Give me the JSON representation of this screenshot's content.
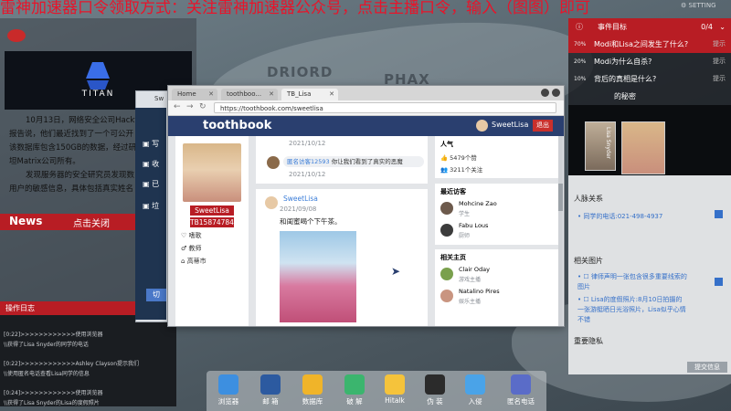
{
  "banner": {
    "text": "雷神加速器口令领取方式：关注雷神加速器公众号，点击主播口令，输入（图图）即可"
  },
  "topbar": {
    "setting_label": "SETTING"
  },
  "map": {
    "labels": [
      "DRIORD",
      "PHAX"
    ]
  },
  "news": {
    "logo_text": "TITAN",
    "paragraphs": [
      "10月13日，网络安全公司Hackt",
      "报告说，他们最近找到了一个可公开",
      "该数据库包含150GB的数据，经过研",
      "坦Matrix公司所有。",
      "发现服务器的安全研究员发现数",
      "用户的敏感信息，具体包括真实姓名"
    ],
    "tab_label": "News",
    "close_label": "点击关闭"
  },
  "opslog": {
    "title": "操作日志",
    "entries": [
      "[0:22]>>>>>>>>>>>>使用浏览器",
      "\\\\获得了Lisa Snyder的同学的电话",
      "[0:22]>>>>>>>>>>>>Ashley Clayson提示我们",
      "\\\\使用匿名电话查看Lisa同学的信息",
      "[0:24]>>>>>>>>>>>>使用浏览器",
      "\\\\获得了Lisa Snyder的Lisa的度假照片"
    ]
  },
  "mailwin": {
    "title_fragment": "Sw",
    "items": [
      "写",
      "收",
      "已",
      "垃"
    ],
    "button": "切"
  },
  "browser": {
    "tabs": [
      "Home",
      "toothboo...",
      "TB_Lisa"
    ],
    "url": "https://toothbook.com/sweetlisa",
    "site_name": "toothbook",
    "user_name": "SweetLisa",
    "logout_label": "退出",
    "profile": {
      "name": "SweetLisa",
      "id": "TB15874784",
      "details": [
        "嗜歌",
        "教师",
        "高蒂市"
      ]
    },
    "feed": {
      "date_top": "2021/10/12",
      "comment_user": "匿名访客12593",
      "comment_text": "你让我们看到了真实的恶魔",
      "comment_date": "2021/10/12",
      "post_user": "SweetLisa",
      "post_date": "2021/09/08",
      "post_text": "和闺蜜喝个下午茶。"
    },
    "popularity": {
      "title": "人气",
      "likes": "5479个赞",
      "follows": "3211个关注"
    },
    "visitors": {
      "title": "最近访客",
      "items": [
        {
          "name": "Mohcine Zao",
          "role": "学生"
        },
        {
          "name": "Fabu Lous",
          "role": "厨师"
        }
      ]
    },
    "related": {
      "title": "相关主页",
      "items": [
        {
          "name": "Clair Oday",
          "role": "游戏主播"
        },
        {
          "name": "Natalino Pires",
          "role": "娱乐主播"
        }
      ]
    }
  },
  "events": {
    "title": "事件目标",
    "count": "0/4",
    "items": [
      {
        "pct": "70%",
        "text": "Modi和Lisa之间发生了什么?",
        "hint": "提示"
      },
      {
        "pct": "20%",
        "text": "Modi为什么自杀?",
        "hint": "提示"
      },
      {
        "pct": "10%",
        "text": "背后的真相是什么?",
        "hint": "提示"
      },
      {
        "pct": "",
        "text": "的秘密",
        "hint": ""
      }
    ]
  },
  "dossier": {
    "photo_label": "Lisa Snyder",
    "relations_title": "人脉关系",
    "relations": [
      "同学的电话:021-498-4937"
    ],
    "photos_title": "相关图片",
    "photos": [
      "律师声明一张包含很多重要线索的图片",
      "Lisa的度假照片:8月10日拍摄的一张游艇晒日光浴照片，Lisa似乎心情不错"
    ],
    "privacy_title": "重要隐私",
    "submit_label": "提交信息"
  },
  "dock": {
    "items": [
      "浏览器",
      "邮 箱",
      "数据库",
      "破 解",
      "Hitalk",
      "伪 装",
      "入侵",
      "匿名电话"
    ]
  },
  "colors": {
    "accent_red": "#b81d24",
    "site_blue": "#2a3f6f",
    "link_blue": "#3b7dd8"
  }
}
